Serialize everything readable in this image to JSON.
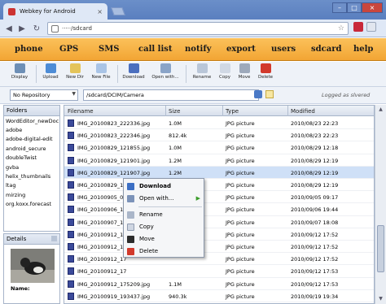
{
  "browser": {
    "tab_title": "Webkey for Android",
    "tab_close": "×",
    "url": "·····/sdcard",
    "win_min": "–",
    "win_max": "□",
    "win_close": "×",
    "back": "◀",
    "forward": "▶",
    "reload": "↻",
    "star": "☆"
  },
  "menu": [
    "phone",
    "GPS",
    "SMS",
    "call list",
    "notify",
    "export",
    "users",
    "sdcard",
    "help"
  ],
  "toolbar": {
    "buttons": [
      {
        "label": "Display",
        "icon": "display-icon",
        "color": "#6d8fb6"
      },
      {
        "label": "Upload",
        "icon": "upload-icon",
        "color": "#4d8cd6"
      },
      {
        "label": "New Dir",
        "icon": "new-folder-icon",
        "color": "#e4c45a"
      },
      {
        "label": "New File",
        "icon": "new-file-icon",
        "color": "#a9c4e6"
      },
      {
        "label": "Download",
        "icon": "download-icon",
        "color": "#4b6fbf"
      },
      {
        "label": "Open with...",
        "icon": "open-with-icon",
        "color": "#8aa4c8"
      },
      {
        "label": "Rename",
        "icon": "rename-icon",
        "color": "#b9c6d8"
      },
      {
        "label": "Copy",
        "icon": "copy-icon",
        "color": "#d0d8e4"
      },
      {
        "label": "Move",
        "icon": "move-icon",
        "color": "#9da9bb"
      },
      {
        "label": "Delete",
        "icon": "delete-icon",
        "color": "#d23a2c"
      }
    ]
  },
  "pathbar": {
    "repository": "No Repository",
    "path": "/sdcard/DCIM/Camera",
    "logged": "Logged as slvered"
  },
  "folders": {
    "title": "Folders",
    "items": [
      "WordEditor_newDoc",
      "adobe",
      "adobe-digital-edit",
      "android_secure",
      "doubleTwist",
      "gvba",
      "helix_thumbnails",
      "ltag",
      "mirzing",
      "org.koxx.forecast"
    ]
  },
  "details": {
    "title": "Details",
    "name": "Name:"
  },
  "grid": {
    "headers": {
      "filename": "Filename",
      "size": "Size",
      "type": "Type",
      "modified": "Modified"
    },
    "rows": [
      {
        "name": "IMG_20100823_222336.jpg",
        "size": "1.0M",
        "type": "JPG picture",
        "modified": "2010/08/23 22:23"
      },
      {
        "name": "IMG_20100823_222346.jpg",
        "size": "812.4k",
        "type": "JPG picture",
        "modified": "2010/08/23 22:23"
      },
      {
        "name": "IMG_20100829_121855.jpg",
        "size": "1.0M",
        "type": "JPG picture",
        "modified": "2010/08/29 12:18"
      },
      {
        "name": "IMG_20100829_121901.jpg",
        "size": "1.2M",
        "type": "JPG picture",
        "modified": "2010/08/29 12:19"
      },
      {
        "name": "IMG_20100829_121907.jpg",
        "size": "1.2M",
        "type": "JPG picture",
        "modified": "2010/08/29 12:19"
      },
      {
        "name": "IMG_20100829_12",
        "size": "",
        "type": "JPG picture",
        "modified": "2010/08/29 12:19"
      },
      {
        "name": "IMG_20100905_09",
        "size": "",
        "type": "JPG picture",
        "modified": "2010/09/05 09:17"
      },
      {
        "name": "IMG_20100906_19",
        "size": "",
        "type": "JPG picture",
        "modified": "2010/09/06 19:44"
      },
      {
        "name": "IMG_20100907_18",
        "size": "",
        "type": "JPG picture",
        "modified": "2010/09/07 18:08"
      },
      {
        "name": "IMG_20100912_17",
        "size": "",
        "type": "JPG picture",
        "modified": "2010/09/12 17:52"
      },
      {
        "name": "IMG_20100912_17",
        "size": "",
        "type": "JPG picture",
        "modified": "2010/09/12 17:52"
      },
      {
        "name": "IMG_20100912_17",
        "size": "",
        "type": "JPG picture",
        "modified": "2010/09/12 17:52"
      },
      {
        "name": "IMG_20100912_17",
        "size": "",
        "type": "JPG picture",
        "modified": "2010/09/12 17:53"
      },
      {
        "name": "IMG_20100912_175209.jpg",
        "size": "1.1M",
        "type": "JPG picture",
        "modified": "2010/09/12 17:53"
      },
      {
        "name": "IMG_20100919_193437.jpg",
        "size": "940.3k",
        "type": "JPG picture",
        "modified": "2010/09/19 19:34"
      },
      {
        "name": "IMG_20100919_193734.jpg",
        "size": "1.0M",
        "type": "JPG picture",
        "modified": "2010/09/19 19:37"
      }
    ]
  },
  "context_menu": {
    "items": [
      {
        "label": "Download",
        "icon": "download-icon",
        "color": "#3c6fc4",
        "bold": true
      },
      {
        "label": "Open with...",
        "icon": "open-with-icon",
        "color": "#7c93b9",
        "submenu": true
      },
      {
        "label": "Rename",
        "icon": "rename-icon",
        "color": "#aab6c9"
      },
      {
        "label": "Copy",
        "icon": "copy-icon",
        "color": "#cfd6e2"
      },
      {
        "label": "Move",
        "icon": "move-icon",
        "color": "#2c2c2c"
      },
      {
        "label": "Delete",
        "icon": "delete-icon",
        "color": "#d23a2c"
      }
    ],
    "submenu_arrow": "▶"
  },
  "colors": {
    "menubar": "#f4a93a",
    "selection": "#cfe0f7"
  }
}
